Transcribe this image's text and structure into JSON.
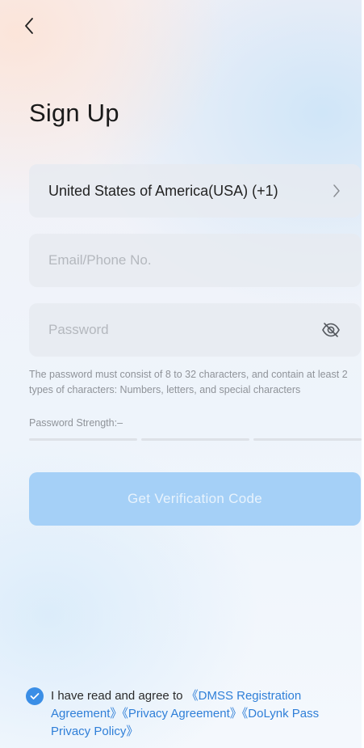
{
  "header": {
    "title": "Sign Up"
  },
  "form": {
    "country": {
      "value": "United States of America(USA) (+1)"
    },
    "email": {
      "placeholder": "Email/Phone No.",
      "value": ""
    },
    "password": {
      "placeholder": "Password",
      "value": ""
    },
    "hint": "The password must consist of 8 to 32 characters, and contain at least 2 types of characters: Numbers, letters, and special characters",
    "strength_label": "Password Strength:–",
    "submit_label": "Get Verification Code"
  },
  "agreement": {
    "checked": true,
    "prefix": "I have read and agree to ",
    "links": [
      "《DMSS Registration Agreement》",
      "《Privacy Agreement》",
      "《DoLynk Pass Privacy Policy》"
    ]
  },
  "colors": {
    "accent": "#3a8ee6",
    "button_disabled": "#a5d0f7",
    "link": "#2f7fd8"
  },
  "icons": {
    "back": "chevron-left-icon",
    "country_arrow": "chevron-right-icon",
    "password_toggle": "eye-off-icon",
    "checkbox": "check-circle-icon"
  }
}
